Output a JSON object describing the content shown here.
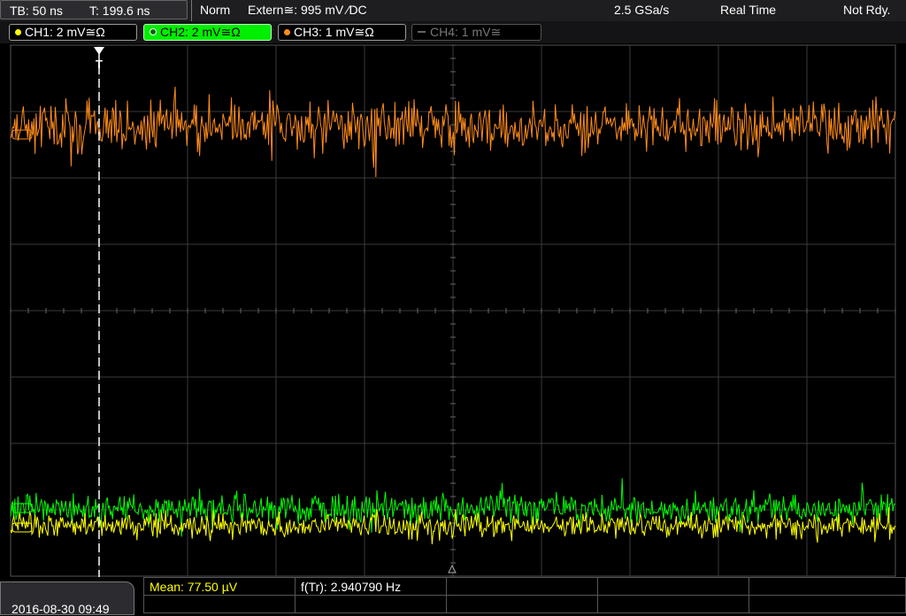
{
  "status": {
    "timebase": "TB: 50 ns",
    "trigger_time": "T: 199.6 ns",
    "mode": "Norm",
    "trigger_source": "Extern≅: 995 mV ∕DC",
    "sample_rate": "2.5 GSa/s",
    "acquire_mode": "Real Time",
    "ready": "Not Rdy."
  },
  "channels": [
    {
      "label": "CH1: 2 mV≅Ω",
      "color": "#ffff00",
      "active": true
    },
    {
      "label": "CH2: 2 mV≅Ω",
      "color": "#00ff00",
      "active": true,
      "selected": true
    },
    {
      "label": "CH3: 1 mV≅Ω",
      "color": "#ff8c1a",
      "active": true
    },
    {
      "label": "CH4: 1 mV≅",
      "color": "#777777",
      "active": false
    }
  ],
  "footer": {
    "datetime": "2016-08-30 09:49",
    "mean": "Mean: 77.50 µV",
    "frequency": "f(Tr): 2.940790 Hz"
  },
  "colors": {
    "ch1": "#ffff00",
    "ch2": "#00ff00",
    "ch3": "#ff8c1a",
    "grid": "#3a3a3a"
  }
}
